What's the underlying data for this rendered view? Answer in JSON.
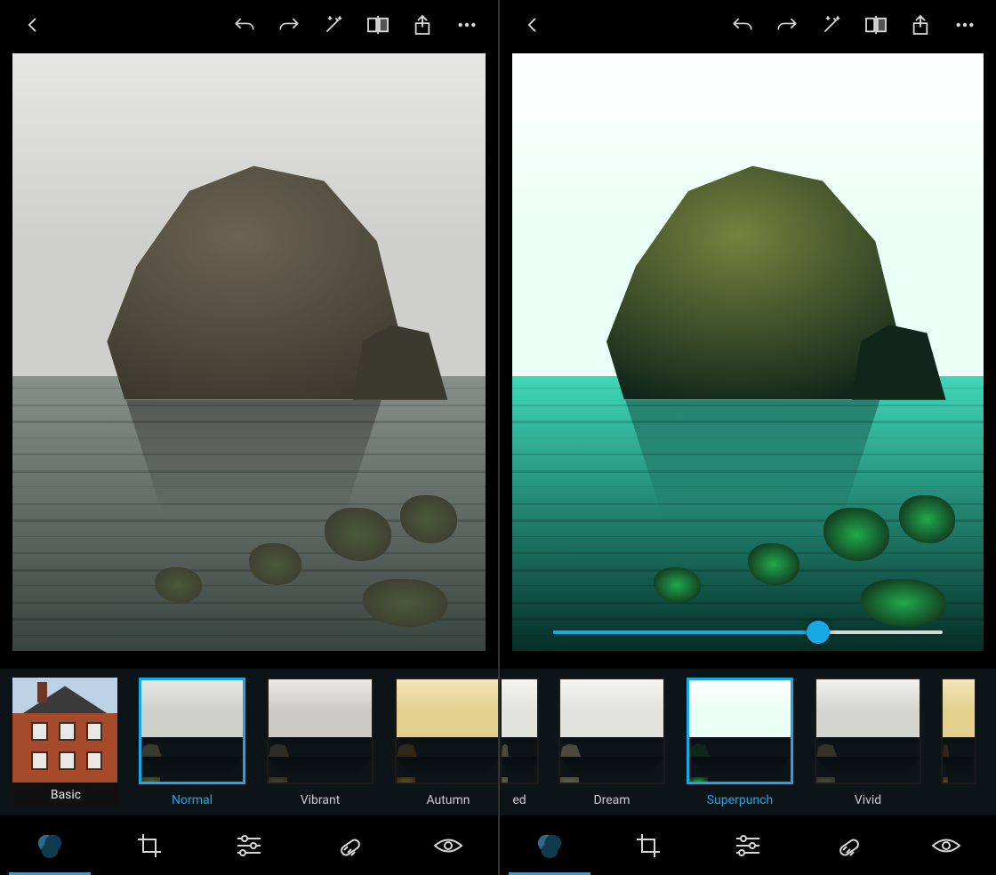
{
  "accent": "#19a8e6",
  "panes": [
    {
      "id": "left",
      "filter_preview": "normal",
      "has_slider": false,
      "strip": {
        "category": {
          "label": "Basic"
        },
        "items": [
          {
            "label": "Normal",
            "selected": true,
            "tone": "normal"
          },
          {
            "label": "Vibrant",
            "selected": false,
            "tone": "vibrant"
          },
          {
            "label": "Autumn",
            "selected": false,
            "tone": "autumn",
            "partial": true
          }
        ]
      }
    },
    {
      "id": "right",
      "filter_preview": "superpunch",
      "has_slider": true,
      "slider_value_pct": 68,
      "strip": {
        "edge_label": "ed",
        "items": [
          {
            "label": "Dream",
            "selected": false,
            "tone": "dream"
          },
          {
            "label": "Superpunch",
            "selected": true,
            "tone": "superpunch"
          },
          {
            "label": "Vivid",
            "selected": false,
            "tone": "vivid"
          },
          {
            "label": "",
            "selected": false,
            "tone": "autumn",
            "partial": true
          }
        ]
      }
    }
  ],
  "tools": {
    "filters": "filters",
    "crop": "crop",
    "adjust": "adjust",
    "heal": "heal",
    "redeye": "redeye"
  }
}
